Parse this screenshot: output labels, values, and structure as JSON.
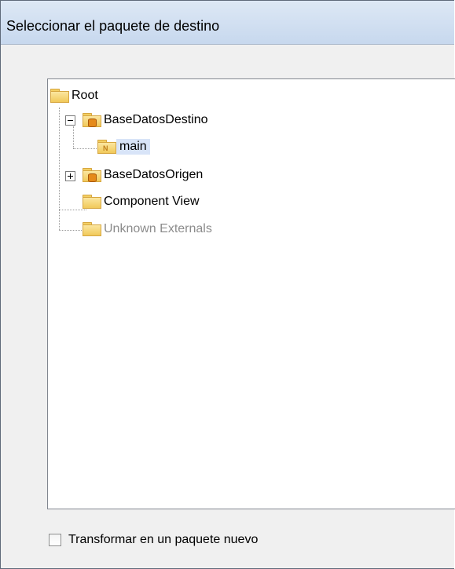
{
  "dialog": {
    "title": "Seleccionar el paquete de destino"
  },
  "tree": {
    "nodes": [
      {
        "label": "Root",
        "icon": "folder-icon"
      },
      {
        "label": "BaseDatosDestino",
        "icon": "database-package-icon",
        "expanded": true
      },
      {
        "label": "main",
        "icon": "namespace-package-icon",
        "selected": true
      },
      {
        "label": "BaseDatosOrigen",
        "icon": "database-package-icon",
        "expanded": false
      },
      {
        "label": "Component View",
        "icon": "folder-icon"
      },
      {
        "label": "Unknown Externals",
        "icon": "folder-icon",
        "disabled": true
      }
    ]
  },
  "options": {
    "transform_label": "Transformar en un paquete nuevo",
    "transform_checked": false
  },
  "colors": {
    "selection": "#d8e4f8",
    "disabled_text": "#8c8c8c",
    "folder": "#f1c95a"
  }
}
